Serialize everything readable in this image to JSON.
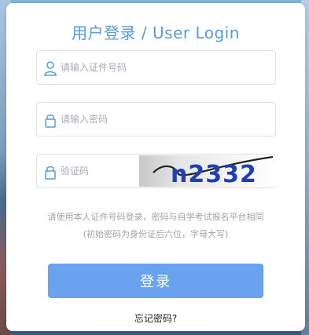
{
  "login": {
    "title": "用户登录 / User Login",
    "id_placeholder": "请输入证件号码",
    "password_placeholder": "请输入密码",
    "captcha_placeholder": "验证码",
    "captcha_text": "n2332",
    "notice_line1": "请使用本人证件号码登录，密码与自学考试报名平台相同",
    "notice_line2": "(初始密码为身份证后六位，字母大写)",
    "login_button": "登录",
    "forgot_link": "忘记密码?"
  },
  "colors": {
    "accent": "#5b9bd5",
    "button": "#6aa2f0",
    "captcha_text": "#1f3fb4"
  },
  "icons": {
    "id_field": "user-icon",
    "password_field": "lock-icon",
    "captcha_field": "lock-icon"
  }
}
